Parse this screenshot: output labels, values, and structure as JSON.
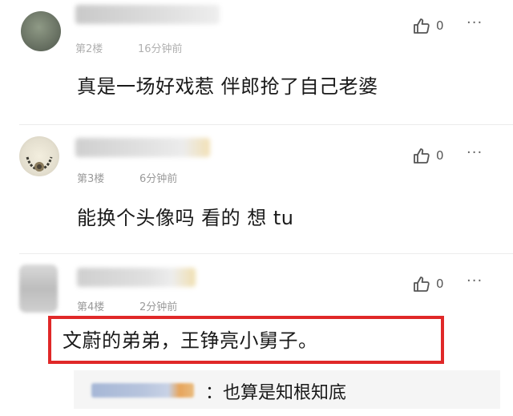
{
  "comments": [
    {
      "floor": "第2楼",
      "time": "16分钟前",
      "likes": "0",
      "more": "···",
      "text": "真是一场好戏惹 伴郎抢了自己老婆"
    },
    {
      "floor": "第3楼",
      "time": "6分钟前",
      "likes": "0",
      "more": "···",
      "text": "能换个头像吗 看的 想 tu"
    },
    {
      "floor": "第4楼",
      "time": "2分钟前",
      "likes": "0",
      "more": "···",
      "text": "文蔚的弟弟，王铮亮小舅子。",
      "highlight_color": "#e02828"
    }
  ],
  "reply": {
    "text": "：也算是知根知底"
  },
  "icons": {
    "like": "thumbs-up-icon",
    "more": "more-dots-icon"
  }
}
